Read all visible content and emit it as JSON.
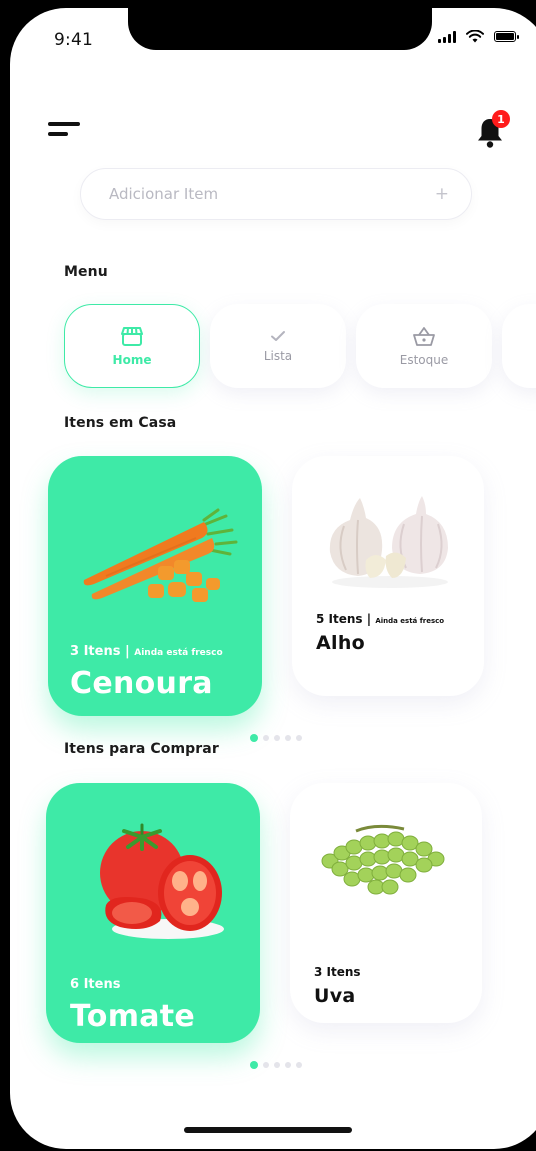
{
  "status_bar": {
    "time": "9:41"
  },
  "header": {
    "notification_count": "1"
  },
  "search": {
    "placeholder": "Adicionar Item",
    "action": "+"
  },
  "menu": {
    "title": "Menu",
    "items": [
      {
        "label": "Home",
        "icon": "store-icon",
        "active": true
      },
      {
        "label": "Lista",
        "icon": "check-icon",
        "active": false
      },
      {
        "label": "Estoque",
        "icon": "basket-icon",
        "active": false
      }
    ]
  },
  "home_items": {
    "title": "Itens em Casa",
    "cards": [
      {
        "count": "3 Itens",
        "separator": "|",
        "status": "Ainda está fresco",
        "name": "Cenoura",
        "image": "carrot-image"
      },
      {
        "count": "5 Itens",
        "separator": "|",
        "status": "Ainda está fresco",
        "name": "Alho",
        "image": "garlic-image"
      }
    ]
  },
  "buy_items": {
    "title": "Itens para Comprar",
    "cards": [
      {
        "count": "6 Itens",
        "name": "Tomate",
        "image": "tomato-image"
      },
      {
        "count": "3 Itens",
        "name": "Uva",
        "image": "grape-image"
      }
    ]
  },
  "colors": {
    "accent": "#3eeaa7",
    "badge": "#ff1b1b",
    "text": "#111111",
    "muted": "#9a9aa4"
  }
}
